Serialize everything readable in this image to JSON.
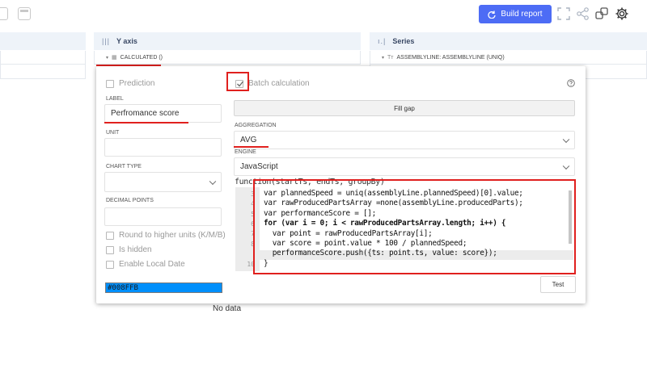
{
  "toolbar": {
    "build_label": "Build report",
    "icons": [
      "fullscreen-icon",
      "share-icon",
      "copy-icon",
      "settings-icon"
    ]
  },
  "columns": {
    "y_axis": {
      "title": "Y axis",
      "sub": "CALCULATED ()"
    },
    "series": {
      "title": "Series",
      "sub": "ASSEMBLYLINE: ASSEMBLYLINE (UNIQ)"
    }
  },
  "modal": {
    "prediction": "Prediction",
    "label_caption": "LABEL",
    "label_value": "Perfromance score",
    "unit_caption": "UNIT",
    "unit_value": "",
    "chart_type_caption": "CHART TYPE",
    "chart_type_value": "",
    "decimal_caption": "DECIMAL POINTS",
    "decimal_value": "",
    "round_units": "Round to higher units (K/M/B)",
    "is_hidden": "Is hidden",
    "local_date": "Enable Local Date",
    "color": "#008FFB",
    "batch": "Batch calculation",
    "fill_gap": "Fill gap",
    "aggregation_caption": "AGGREGATION",
    "aggregation_value": "AVG",
    "engine_caption": "ENGINE",
    "engine_value": "JavaScript",
    "signature": "function(startTs, endTs, groupBy)",
    "test": "Test"
  },
  "code": {
    "line_numbers": [
      "3",
      "4",
      "5",
      "6",
      "7",
      "8",
      "9",
      "10"
    ],
    "lines": [
      "var plannedSpeed = uniq(assemblyLine.plannedSpeed)[0].value;",
      "var rawProducedPartsArray =none(assemblyLine.producedParts);",
      "var performanceScore = [];",
      "for (var i = 0; i < rawProducedPartsArray.length; i++) {",
      "  var point = rawProducedPartsArray[i];",
      "  var score = point.value * 100 / plannedSpeed;",
      "  performanceScore.push({ts: point.ts, value: score});",
      "}"
    ]
  },
  "status": {
    "no_data": "No data"
  },
  "colors": {
    "accent": "#4d6cf5",
    "highlight": "#e0201e",
    "swatch": "#008ffb"
  }
}
